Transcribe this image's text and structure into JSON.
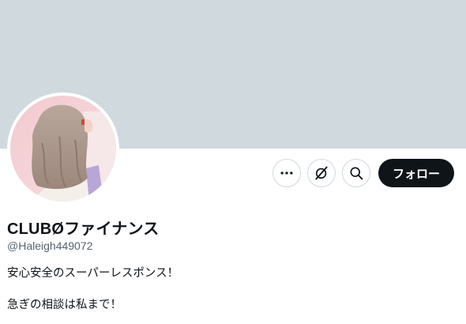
{
  "profile": {
    "display_name": "CLUBØファイナンス",
    "handle": "@Haleigh449072",
    "bio_lines": [
      "安心安全のスーパーレスポンス！",
      "急ぎの相談は私まで！"
    ]
  },
  "actions": {
    "more_icon": "more-horizontal-icon",
    "grok_icon": "grok-icon",
    "search_icon": "search-icon",
    "follow_label": "フォロー"
  },
  "colors": {
    "banner": "#cfd9de",
    "follow_button_bg": "#0f1419",
    "follow_button_text": "#ffffff",
    "handle_text": "#536471",
    "border": "#cfd9de"
  }
}
